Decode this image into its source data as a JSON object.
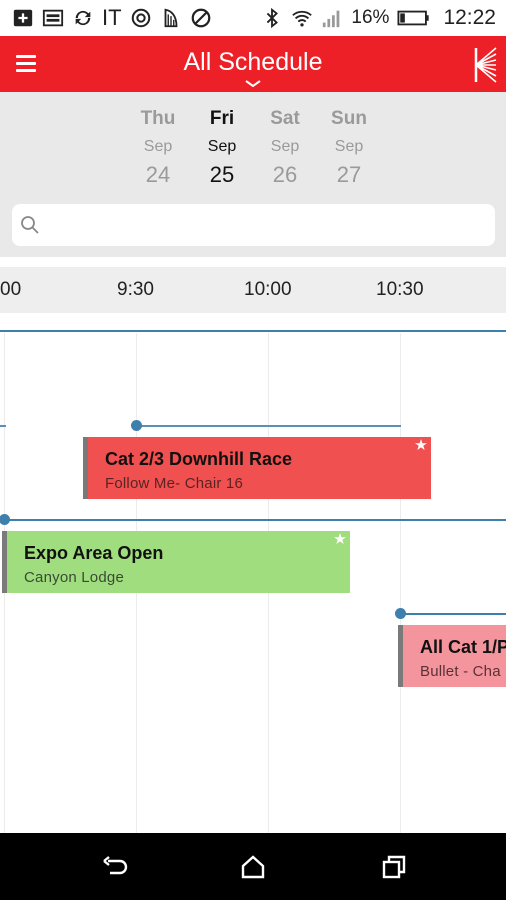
{
  "status_bar": {
    "carrier": "IT",
    "battery_percent": "16%",
    "time": "12:22",
    "icons": [
      "add-box-icon",
      "image-icon",
      "sync-icon",
      "carrier-text",
      "at-icon",
      "harp-icon",
      "no-disturb-icon",
      "bluetooth-icon",
      "wifi-icon",
      "signal-icon",
      "battery-icon"
    ]
  },
  "app_bar": {
    "menu_icon": "hamburger-menu-icon",
    "title": "All Schedule",
    "title_chevron_icon": "chevron-down-icon",
    "logo_icon": "brand-logo-icon",
    "color": "#ee2027"
  },
  "date_strip": {
    "days": [
      {
        "dow": "Thu",
        "month": "Sep",
        "day": "24",
        "selected": false
      },
      {
        "dow": "Fri",
        "month": "Sep",
        "day": "25",
        "selected": true
      },
      {
        "dow": "Sat",
        "month": "Sep",
        "day": "26",
        "selected": false
      },
      {
        "dow": "Sun",
        "month": "Sep",
        "day": "27",
        "selected": false
      }
    ]
  },
  "search": {
    "icon": "search-icon",
    "placeholder": "",
    "value": ""
  },
  "timeline": {
    "time_labels": [
      "00",
      "9:30",
      "10:00",
      "10:30"
    ],
    "events": [
      {
        "title": "Cat 2/3 Downhill Race",
        "subtitle": "Follow Me- Chair 16",
        "color": "#f0504f",
        "icon": "star-icon"
      },
      {
        "title": "Expo Area Open",
        "subtitle": "Canyon Lodge",
        "color": "#9fdd7e",
        "icon": "star-icon"
      },
      {
        "title": "All Cat 1/P",
        "subtitle": "Bullet - Cha",
        "color": "#f4949c",
        "icon": ""
      }
    ],
    "line_color": "#3f7fab"
  },
  "nav_bar": {
    "icons": [
      "back-icon",
      "home-icon",
      "recents-icon"
    ]
  }
}
